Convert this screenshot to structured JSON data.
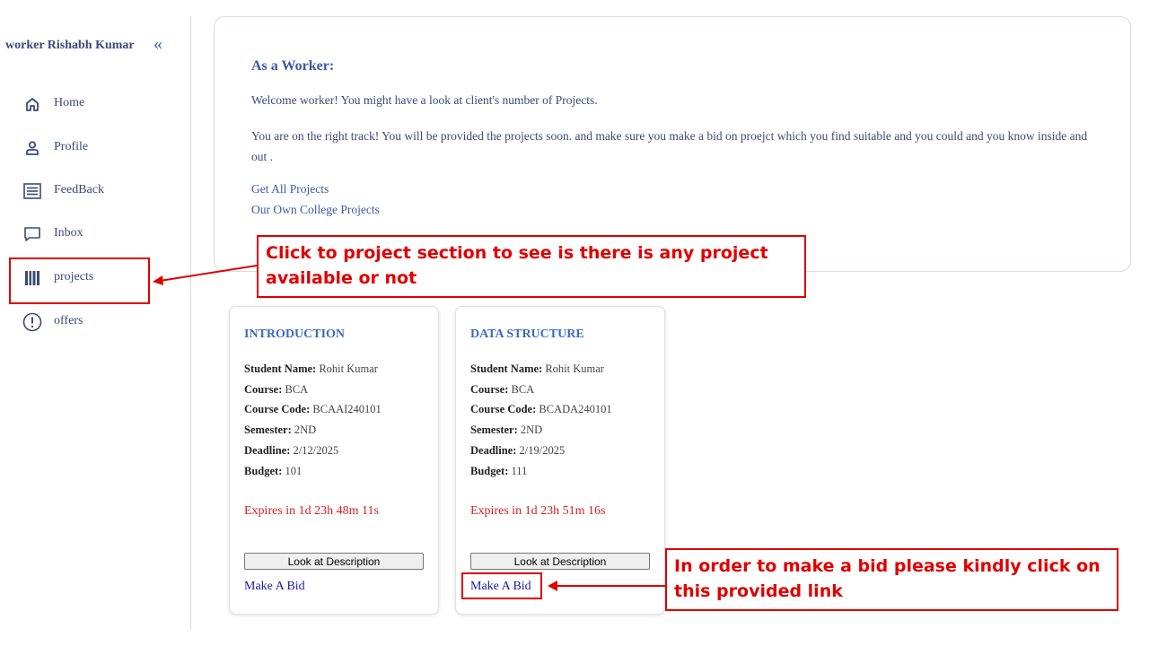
{
  "sidebar": {
    "user_name": "worker Rishabh Kumar",
    "collapse_icon": "«",
    "items": [
      {
        "label": "Home",
        "icon": "home-icon"
      },
      {
        "label": "Profile",
        "icon": "user-icon"
      },
      {
        "label": "FeedBack",
        "icon": "list-icon"
      },
      {
        "label": "Inbox",
        "icon": "inbox-icon"
      },
      {
        "label": "projects",
        "icon": "barcode-icon"
      },
      {
        "label": "offers",
        "icon": "alert-circle-icon"
      }
    ]
  },
  "info": {
    "title": "As a Worker:",
    "paragraph1": "Welcome worker! You might have a look at client's number of Projects.",
    "paragraph2": "You are on the right track! You will be provided the projects soon. and make sure you make a bid on proejct which you find suitable and you could and you know inside and out .",
    "links": [
      "Get All Projects",
      "Our Own College Projects"
    ]
  },
  "field_labels": {
    "student_name": "Student Name:",
    "course": "Course:",
    "course_code": "Course Code:",
    "semester": "Semester:",
    "deadline": "Deadline:",
    "budget": "Budget:"
  },
  "projects": [
    {
      "title": "INTRODUCTION",
      "student_name": "Rohit Kumar",
      "course": "BCA",
      "course_code": "BCAAI240101",
      "semester": "2ND",
      "deadline": "2/12/2025",
      "budget": "101",
      "expires": "Expires in 1d 23h 48m 11s",
      "description_button": "Look at Description",
      "bid_link": "Make A Bid"
    },
    {
      "title": "DATA STRUCTURE",
      "student_name": "Rohit Kumar",
      "course": "BCA",
      "course_code": "BCADA240101",
      "semester": "2ND",
      "deadline": "2/19/2025",
      "budget": "111",
      "expires": "Expires in 1d 23h 51m 16s",
      "description_button": "Look at Description",
      "bid_link": "Make A Bid"
    }
  ],
  "annotations": {
    "projects_note": "Click to project section to see is there is any project available or not",
    "bid_note": "In order to make a bid please kindly click on this provided link"
  },
  "colors": {
    "accent": "#3a5aa8",
    "annotation": "#e00000",
    "expires": "#d42020"
  }
}
